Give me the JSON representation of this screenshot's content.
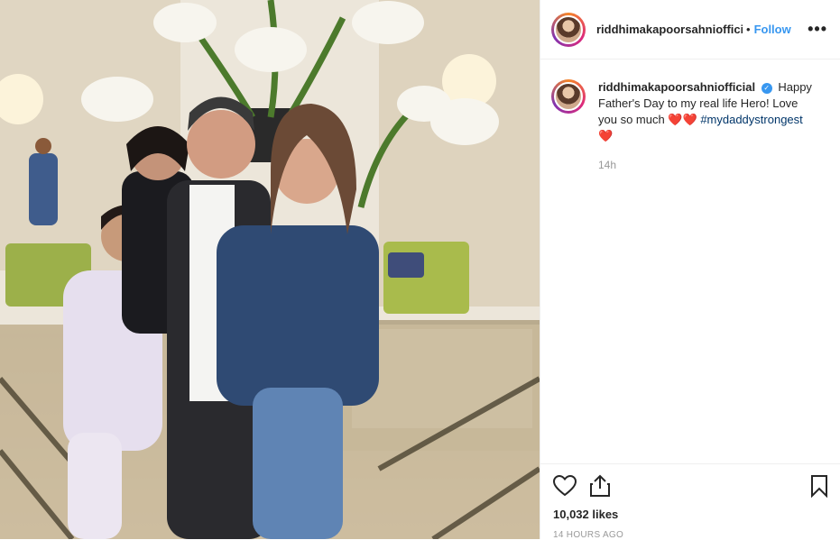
{
  "post": {
    "username": "riddhimakapoorsahniofficial",
    "username_truncated": "riddhimakapoorsahniofficial",
    "dot": "•",
    "follow_label": "Follow",
    "more_label": "•••",
    "caption": {
      "username": "riddhimakapoorsahniofficial",
      "verified_mark": "✓",
      "text": "Happy Father's Day to my real life Hero! Love you so much ❤️❤️ ",
      "hashtag": "#mydaddystrongest",
      "trailing": "❤️"
    },
    "caption_age": "14h",
    "likes": "10,032 likes",
    "posted_time": "14 HOURS AGO"
  },
  "icons": {
    "like": "heart-icon",
    "share": "share-icon",
    "save": "bookmark-icon",
    "more": "more-options-icon",
    "avatar": "profile-avatar"
  },
  "colors": {
    "follow": "#3897f0",
    "hashtag": "#003569",
    "muted": "#999999",
    "text": "#262626"
  }
}
